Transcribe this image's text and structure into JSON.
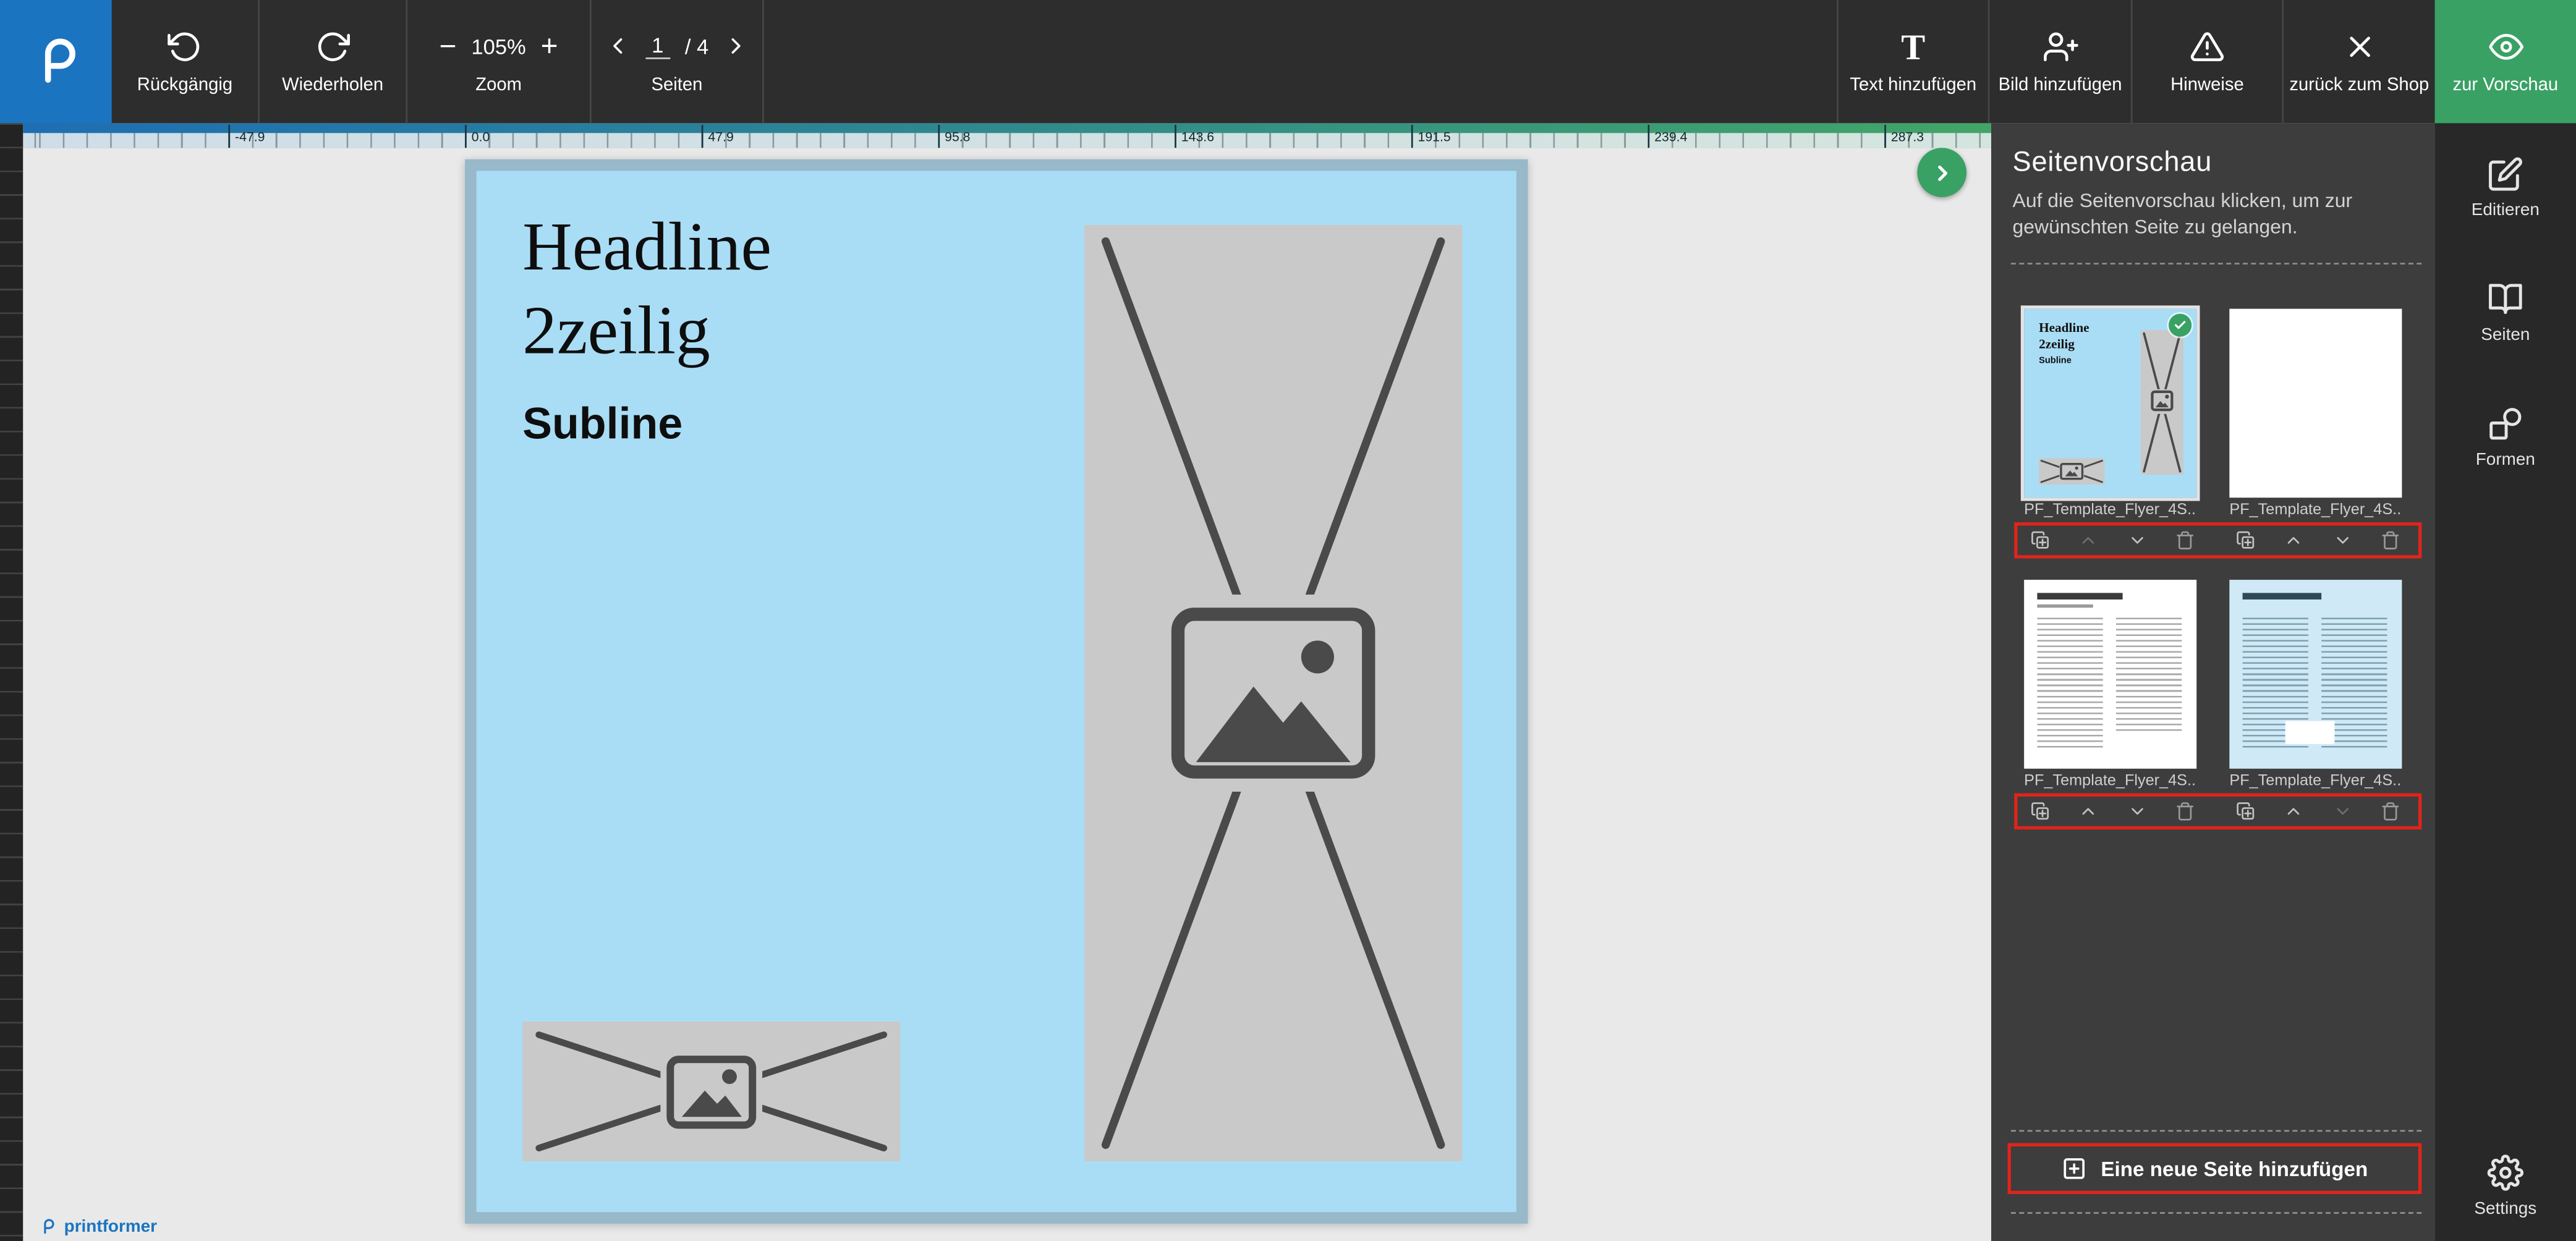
{
  "colors": {
    "accent_green": "#3aa164",
    "annotation_red": "#e0241c",
    "flyer_blue": "#a9ddf5",
    "flyer_border": "#97b9c9",
    "placeholder_gray": "#c9c9c9",
    "placeholder_dark": "#4a4a4a",
    "brand_blue": "#1b74c0"
  },
  "toolbar": {
    "undo_label": "Rückgängig",
    "redo_label": "Wiederholen",
    "zoom": {
      "minus": "−",
      "value": "105%",
      "plus": "+",
      "label": "Zoom"
    },
    "pages": {
      "current": "1",
      "total": "/ 4",
      "label": "Seiten"
    },
    "add_text_label": "Text hinzufügen",
    "add_image_label": "Bild hinzufügen",
    "hints_label": "Hinweise",
    "back_to_shop_label": "zurück zum Shop",
    "preview_label": "zur Vorschau"
  },
  "ruler": {
    "ticks": [
      "-47.9",
      "0.0",
      "47.9",
      "95.8",
      "143.6",
      "191.5",
      "239.4",
      "287.3"
    ]
  },
  "artboard": {
    "headline_line1": "Headline",
    "headline_line2": "2zeilig",
    "subline": "Subline"
  },
  "pages_panel": {
    "title": "Seitenvorschau",
    "subtitle": "Auf die Seitenvorschau klicken, um zur gewünschten Seite zu gelangen.",
    "thumbnails": [
      {
        "label": "PF_Template_Flyer_4S..."
      },
      {
        "label": "PF_Template_Flyer_4S..."
      },
      {
        "label": "PF_Template_Flyer_4S..."
      },
      {
        "label": "PF_Template_Flyer_4S..."
      }
    ],
    "add_page_label": "Eine neue Seite hinzufügen"
  },
  "sidebar": {
    "items": [
      {
        "label": "Editieren"
      },
      {
        "label": "Seiten"
      },
      {
        "label": "Formen"
      },
      {
        "label": "Settings"
      }
    ]
  },
  "footer": {
    "brand": "printformer"
  },
  "icons": {
    "undo": "rotate-ccw",
    "redo": "rotate-cw",
    "zoom_out": "minus",
    "zoom_in": "plus",
    "prev_page": "chevron-left",
    "next_page": "chevron-right",
    "add_text": "letter-T",
    "add_image": "user-plus",
    "hints": "warning-triangle",
    "back_to_shop": "x",
    "preview": "eye",
    "panel_toggle": "chevron-right",
    "selected_page": "check-circle",
    "duplicate_page": "copy-plus",
    "move_up": "chevron-up",
    "move_down": "chevron-down",
    "delete_page": "trash",
    "add_page": "plus-square",
    "edit": "pencil-square",
    "pages": "open-book",
    "shapes": "circle-square",
    "settings": "gear",
    "brand": "printformer-swirl",
    "image_placeholder": "picture-frame"
  }
}
